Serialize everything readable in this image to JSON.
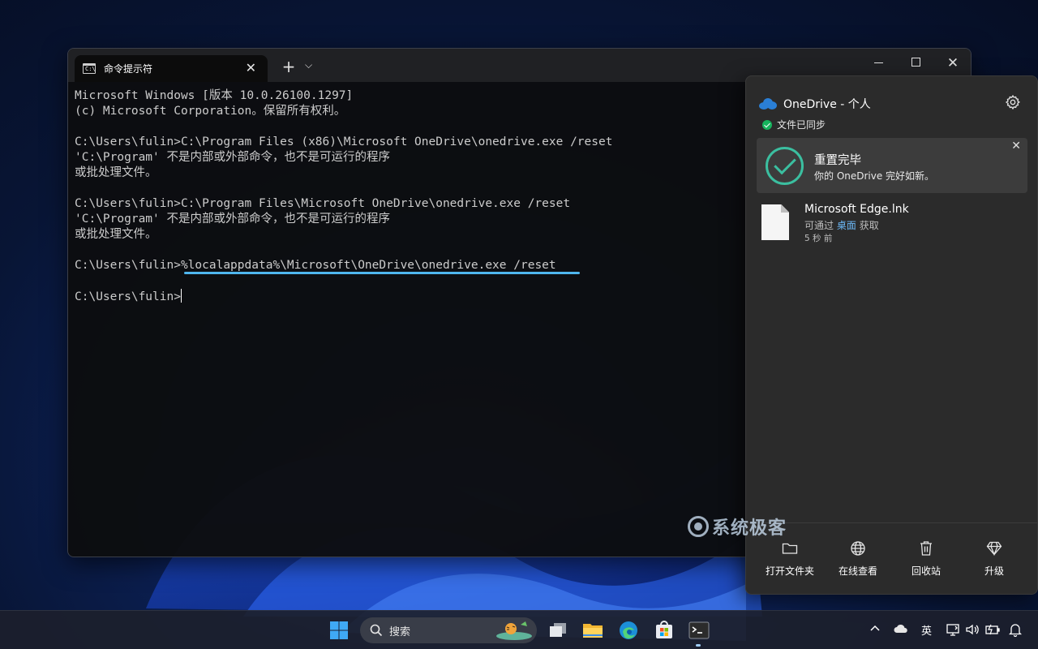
{
  "terminal": {
    "tab_title": "命令提示符",
    "lines": [
      "Microsoft Windows [版本 10.0.26100.1297]",
      "(c) Microsoft Corporation。保留所有权利。",
      "",
      "C:\\Users\\fulin>C:\\Program Files (x86)\\Microsoft OneDrive\\onedrive.exe /reset",
      "'C:\\Program' 不是内部或外部命令，也不是可运行的程序",
      "或批处理文件。",
      "",
      "C:\\Users\\fulin>C:\\Program Files\\Microsoft OneDrive\\onedrive.exe /reset",
      "'C:\\Program' 不是内部或外部命令，也不是可运行的程序",
      "或批处理文件。",
      ""
    ],
    "highlight_prompt": "C:\\Users\\fulin>",
    "highlight_command": "%localappdata%\\Microsoft\\OneDrive\\onedrive.exe /reset",
    "current_prompt": "C:\\Users\\fulin>"
  },
  "onedrive": {
    "title": "OneDrive - 个人",
    "sync_status": "文件已同步",
    "notice_title": "重置完毕",
    "notice_text": "你的 OneDrive 完好如新。",
    "file_name": "Microsoft Edge.lnk",
    "file_sub_prefix": "可通过",
    "file_sub_link": "桌面",
    "file_sub_suffix": "获取",
    "file_time": "5 秒 前",
    "footer": [
      {
        "label": "打开文件夹",
        "icon": "folder-icon"
      },
      {
        "label": "在线查看",
        "icon": "globe-icon"
      },
      {
        "label": "回收站",
        "icon": "trash-icon"
      },
      {
        "label": "升级",
        "icon": "diamond-icon"
      }
    ]
  },
  "watermark": "系统极客",
  "taskbar": {
    "search_label": "搜索",
    "ime": "英",
    "icons": [
      "windows-start-icon",
      "search-icon",
      "task-view-icon",
      "file-explorer-icon",
      "edge-icon",
      "store-icon",
      "terminal-icon",
      "chevron-up-icon",
      "onedrive-cloud-icon",
      "network-icon",
      "volume-icon",
      "battery-icon",
      "bell-icon"
    ]
  },
  "colors": {
    "accent": "#4fb6ee",
    "success": "#16b35d",
    "check_teal": "#3bbfa0",
    "link": "#6bb7f5"
  }
}
